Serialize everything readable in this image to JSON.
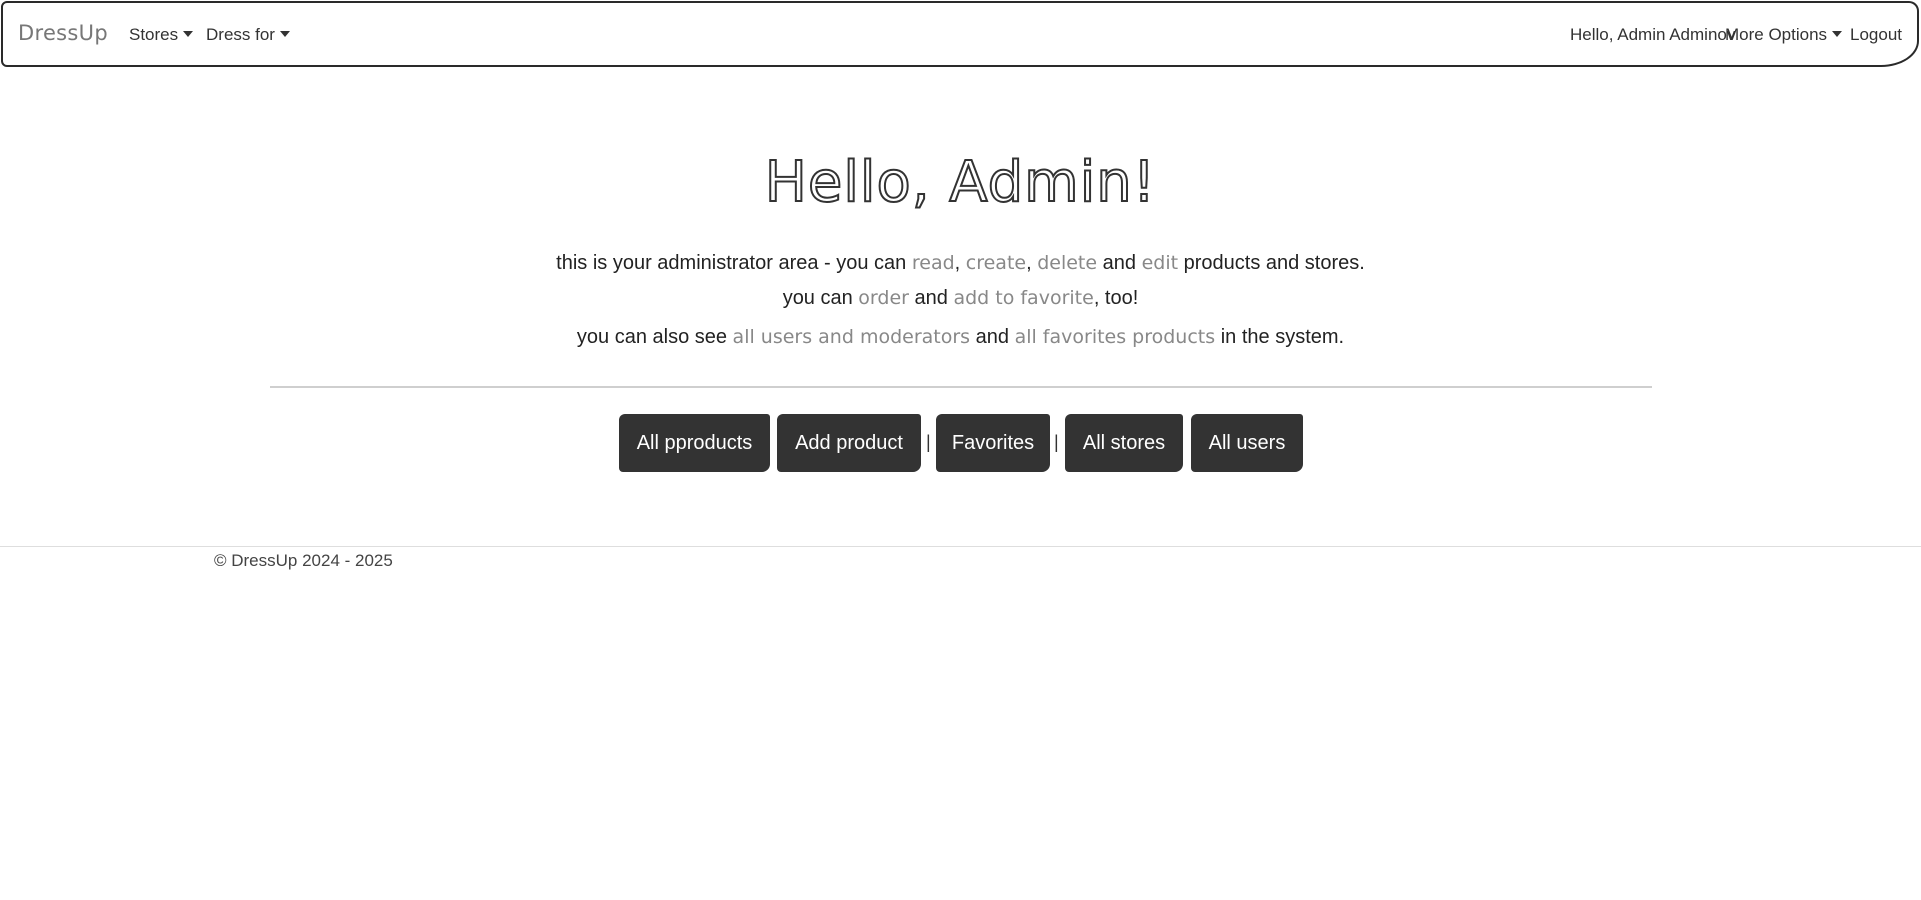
{
  "navbar": {
    "brand": "DressUp",
    "stores": "Stores",
    "dress_for": "Dress for",
    "greeting": "Hello, Admin Adminov",
    "more_options": "More Options",
    "logout": "Logout"
  },
  "hero": {
    "title": "Hello, Admin!",
    "line1": {
      "pre": "this is your administrator area - you can ",
      "read": "read",
      "c1": ", ",
      "create": "create",
      "c2": ", ",
      "delete": "delete",
      "and": " and ",
      "edit": "edit",
      "post": " products and stores."
    },
    "line2": {
      "pre": "you can ",
      "order": "order",
      "and": " and ",
      "favorite": "add to favorite",
      "post": ", too!"
    },
    "line3": {
      "pre": "you can also see ",
      "users": "all users and moderators",
      "and": " and ",
      "favorites": "all favorites products",
      "post": " in the system."
    }
  },
  "actions": {
    "all_products": "All pproducts",
    "add_product": "Add product",
    "sep": "|",
    "favorites": "Favorites",
    "all_stores": "All stores",
    "all_users": "All users"
  },
  "footer": {
    "text": "© DressUp 2024 - 2025"
  }
}
